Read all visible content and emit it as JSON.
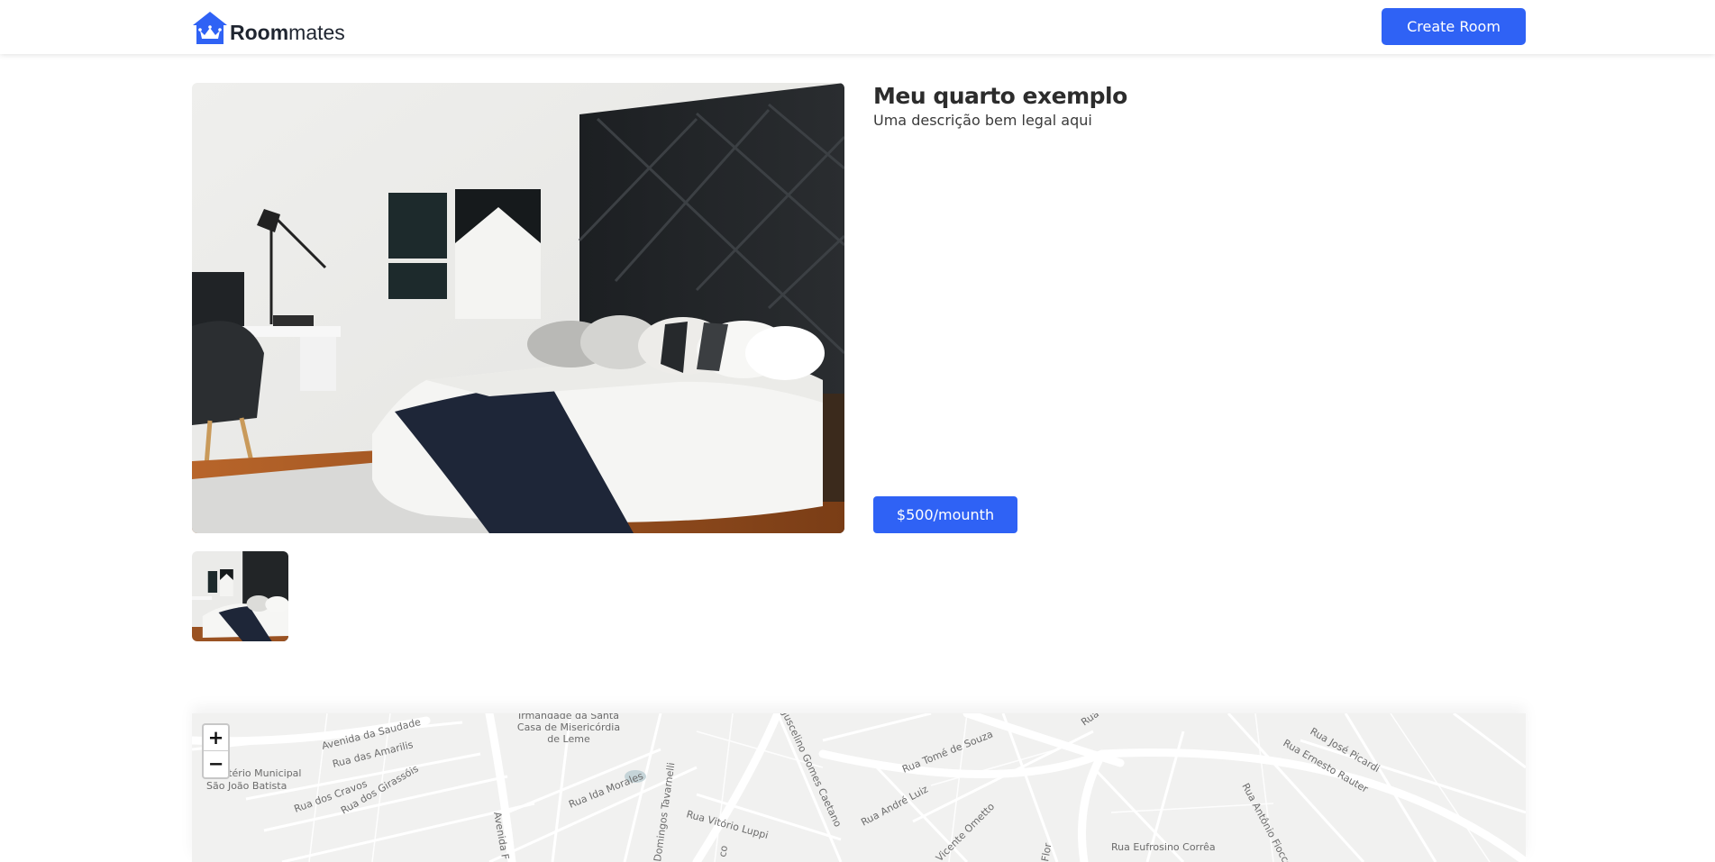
{
  "header": {
    "logo_bold": "Room",
    "logo_regular": "mates",
    "create_button_label": "Create Room"
  },
  "room": {
    "title": "Meu quarto exemplo",
    "description": "Uma descrição bem legal aqui",
    "price_label": "$500/mounth"
  },
  "map": {
    "zoom_in_label": "+",
    "zoom_out_label": "−",
    "labels": {
      "avenida_saudade": "Avenida da Saudade",
      "rua_amarilis": "Rua das Amarilis",
      "rua_cravos": "Rua dos Cravos",
      "rua_girassois": "Rua dos Girassóis",
      "cemiterio_1": "Cemitério Municipal",
      "cemiterio_2": "São João Batista",
      "santa_casa_1": "Irmandade da Santa",
      "santa_casa_2": "Casa de Misericórdia",
      "santa_casa_3": "de Leme",
      "avenida_f": "Avenida F",
      "rua_ida_morales": "Rua Ida Morales",
      "domingos_tavarnelli": "Domingos Tavarnelli",
      "rua_vitorio_luppi": "Rua Vitório Luppi",
      "gomes_caetano": "Juscelino Gomes Caetano",
      "rua_tome_souza": "Rua Tomé de Souza",
      "rua_andre_luiz": "Rua André Luiz",
      "rua_jose_picardi": "Rua José Picardi",
      "rua_ernesto_rauter": "Rua Ernesto Rauter",
      "rua_antonio_fiocco": "Rua Antônio Fiocco",
      "rua_eufrosino_correa": "Rua Eufrosino Corrêa",
      "ometto": "Vicente Ometto",
      "flor": "Flor",
      "rua_top": "Rua",
      "co": "co"
    }
  },
  "colors": {
    "accent": "#2f62f5",
    "map_bg": "#f1f1f0",
    "road": "#ffffff",
    "water": "#c5d4d8"
  }
}
